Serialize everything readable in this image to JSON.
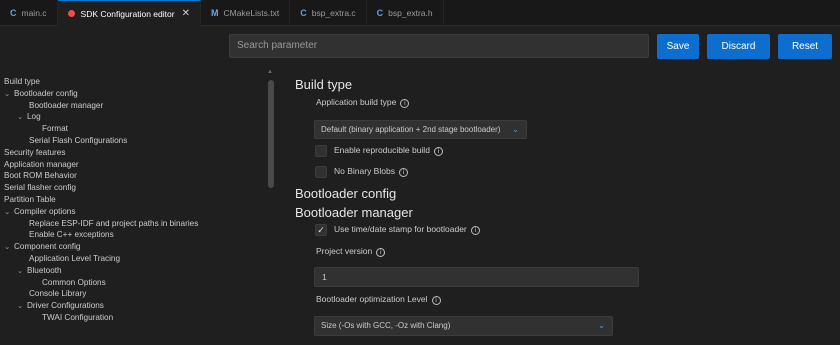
{
  "tabs": [
    {
      "icon": "C",
      "icon_name": "c-file-icon",
      "label": "main.c",
      "active": false
    },
    {
      "icon": "",
      "icon_name": "modified-dot-icon",
      "label": "SDK Configuration editor",
      "active": true
    },
    {
      "icon": "M",
      "icon_name": "cmake-file-icon",
      "label": "CMakeLists.txt",
      "active": false
    },
    {
      "icon": "C",
      "icon_name": "c-file-icon",
      "label": "bsp_extra.c",
      "active": false
    },
    {
      "icon": "C",
      "icon_name": "c-file-icon",
      "label": "bsp_extra.h",
      "active": false
    }
  ],
  "toolbar": {
    "search_placeholder": "Search parameter",
    "save_label": "Save",
    "discard_label": "Discard",
    "reset_label": "Reset"
  },
  "tree": [
    {
      "label": "Build type",
      "indent": 0,
      "chevron": false
    },
    {
      "label": "Bootloader config",
      "indent": 1,
      "chevron": true
    },
    {
      "label": "Bootloader manager",
      "indent": 2,
      "chevron": false
    },
    {
      "label": "Log",
      "indent": 2,
      "chevron": true
    },
    {
      "label": "Format",
      "indent": 3,
      "chevron": false
    },
    {
      "label": "Serial Flash Configurations",
      "indent": 2,
      "chevron": false
    },
    {
      "label": "Security features",
      "indent": 0,
      "chevron": false
    },
    {
      "label": "Application manager",
      "indent": 0,
      "chevron": false
    },
    {
      "label": "Boot ROM Behavior",
      "indent": 0,
      "chevron": false
    },
    {
      "label": "Serial flasher config",
      "indent": 0,
      "chevron": false
    },
    {
      "label": "Partition Table",
      "indent": 0,
      "chevron": false
    },
    {
      "label": "Compiler options",
      "indent": 1,
      "chevron": true
    },
    {
      "label": "Replace ESP-IDF and project paths in binaries",
      "indent": 2,
      "chevron": false
    },
    {
      "label": "Enable C++ exceptions",
      "indent": 2,
      "chevron": false
    },
    {
      "label": "Component config",
      "indent": 1,
      "chevron": true
    },
    {
      "label": "Application Level Tracing",
      "indent": 2,
      "chevron": false
    },
    {
      "label": "Bluetooth",
      "indent": 2,
      "chevron": true
    },
    {
      "label": "Common Options",
      "indent": 3,
      "chevron": false
    },
    {
      "label": "Console Library",
      "indent": 2,
      "chevron": false
    },
    {
      "label": "Driver Configurations",
      "indent": 2,
      "chevron": true
    },
    {
      "label": "TWAI Configuration",
      "indent": 3,
      "chevron": false
    }
  ],
  "content": {
    "build_type_heading": "Build type",
    "app_build_type_label": "Application build type",
    "app_build_type_value": "Default (binary application + 2nd stage bootloader)",
    "reproducible_label": "Enable reproducible build",
    "reproducible_checked": false,
    "no_blobs_label": "No Binary Blobs",
    "no_blobs_checked": false,
    "bootloader_config_heading": "Bootloader config",
    "bootloader_manager_heading": "Bootloader manager",
    "timestamp_label": "Use time/date stamp for bootloader",
    "timestamp_checked": true,
    "project_version_label": "Project version",
    "project_version_value": "1",
    "optimization_label": "Bootloader optimization Level",
    "optimization_value": "Size (-Os with GCC, -Oz with Clang)"
  },
  "icons": {
    "info": "info-icon",
    "chevron": "chevron-down-icon",
    "check": "checkmark-icon"
  },
  "colors": {
    "accent": "#0e6ecf",
    "background": "#1f1f1f",
    "modified_dot": "#f14c4c"
  }
}
